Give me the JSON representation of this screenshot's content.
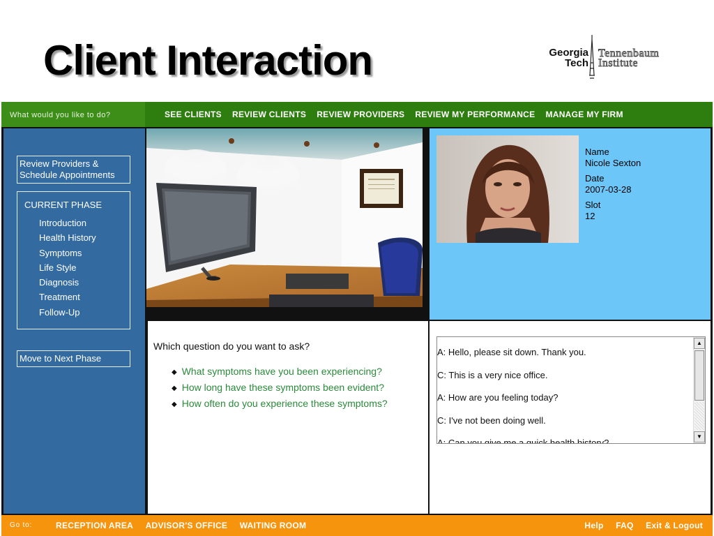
{
  "slide": {
    "title": "Client Interaction",
    "logo": {
      "left_line1": "Georgia",
      "left_line2": "Tech",
      "right_line1": "Tennenbaum",
      "right_line2": "Institute"
    }
  },
  "topnav": {
    "prompt": "What would you like to do?",
    "links": [
      "SEE CLIENTS",
      "REVIEW CLIENTS",
      "REVIEW PROVIDERS",
      "REVIEW MY PERFORMANCE",
      "MANAGE MY FIRM"
    ]
  },
  "sidebar": {
    "review_providers": "Review Providers & Schedule Appointments",
    "current_phase_title": "CURRENT PHASE",
    "phases": [
      "Introduction",
      "Health History",
      "Symptoms",
      "Life Style",
      "Diagnosis",
      "Treatment",
      "Follow-Up"
    ],
    "next_phase": "Move to Next Phase"
  },
  "client": {
    "name_label": "Name",
    "name": "Nicole Sexton",
    "date_label": "Date",
    "date": "2007-03-28",
    "slot_label": "Slot",
    "slot": "12"
  },
  "questions": {
    "prompt": "Which question do you want to ask?",
    "items": [
      "What symptoms have you been experiencing?",
      "How long have these symptoms been evident?",
      "How often do you experience these symptoms?"
    ]
  },
  "conversation": {
    "lines": [
      "A: Hello, please sit down.  Thank you.",
      "C: This is a very nice office.",
      "A: How are you feeling today?",
      "C: I've not been doing well.",
      "A: Can you give me a quick health history?"
    ]
  },
  "bottomnav": {
    "goto_label": "Go to:",
    "left_links": [
      "RECEPTION AREA",
      "ADVISOR'S OFFICE",
      "WAITING ROOM"
    ],
    "right_links": [
      "Help",
      "FAQ",
      "Exit & Logout"
    ]
  },
  "colors": {
    "topnav_green": "#2e7d0f",
    "sidebar_blue": "#336aa0",
    "client_panel_blue": "#6cc6f8",
    "bottomnav_orange": "#f7940d",
    "question_green": "#2a8a3a"
  }
}
